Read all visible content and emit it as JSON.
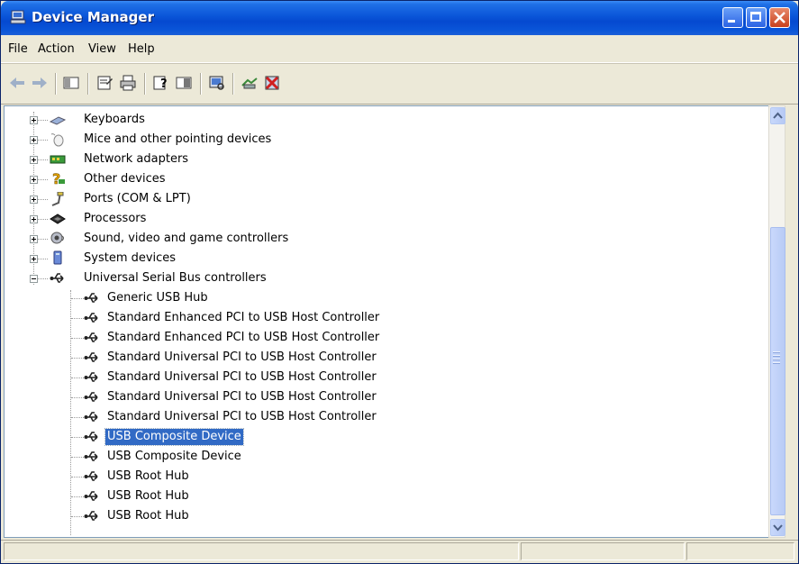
{
  "window": {
    "title": "Device Manager",
    "controls": [
      "minimize",
      "maximize",
      "close"
    ]
  },
  "menu": {
    "items": [
      {
        "label": "File"
      },
      {
        "label": "Action"
      },
      {
        "label": "View"
      },
      {
        "label": "Help"
      }
    ]
  },
  "toolbar": {
    "icons": [
      "back-arrow-icon",
      "forward-arrow-icon",
      "show-hide-tree-icon",
      "properties-icon",
      "print-icon",
      "help-icon",
      "view-icon",
      "scan-hardware-icon",
      "update-driver-icon",
      "uninstall-icon"
    ]
  },
  "tree": {
    "categories": [
      {
        "label": "Keyboards",
        "icon": "keyboard-icon",
        "expanded": false
      },
      {
        "label": "Mice and other pointing devices",
        "icon": "mouse-icon",
        "expanded": false
      },
      {
        "label": "Network adapters",
        "icon": "network-adapter-icon",
        "expanded": false
      },
      {
        "label": "Other devices",
        "icon": "unknown-device-icon",
        "expanded": false
      },
      {
        "label": "Ports (COM & LPT)",
        "icon": "port-icon",
        "expanded": false
      },
      {
        "label": "Processors",
        "icon": "processor-icon",
        "expanded": false
      },
      {
        "label": "Sound, video and game controllers",
        "icon": "sound-icon",
        "expanded": false
      },
      {
        "label": "System devices",
        "icon": "system-device-icon",
        "expanded": false
      },
      {
        "label": "Universal Serial Bus controllers",
        "icon": "usb-icon",
        "expanded": true
      }
    ],
    "usb_children": [
      {
        "label": "Generic USB Hub"
      },
      {
        "label": "Standard Enhanced PCI to USB Host Controller"
      },
      {
        "label": "Standard Enhanced PCI to USB Host Controller"
      },
      {
        "label": "Standard Universal PCI to USB Host Controller"
      },
      {
        "label": "Standard Universal PCI to USB Host Controller"
      },
      {
        "label": "Standard Universal PCI to USB Host Controller"
      },
      {
        "label": "Standard Universal PCI to USB Host Controller"
      },
      {
        "label": "USB Composite Device",
        "selected": true
      },
      {
        "label": "USB Composite Device"
      },
      {
        "label": "USB Root Hub"
      },
      {
        "label": "USB Root Hub"
      },
      {
        "label": "USB Root Hub"
      }
    ]
  },
  "colors": {
    "title_bar": "#0a55d8",
    "selection": "#316ac5",
    "chrome": "#ece9d8"
  }
}
